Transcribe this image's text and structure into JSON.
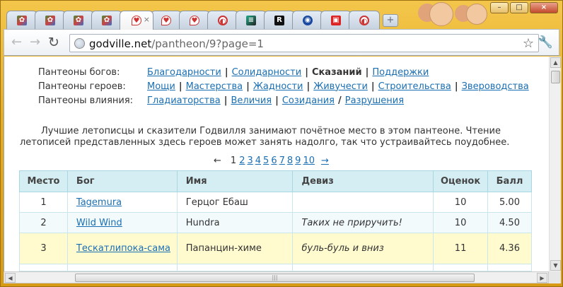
{
  "browser": {
    "tabs": [
      {
        "icon": "godville-icon",
        "glyph": "✿"
      },
      {
        "icon": "godville-icon",
        "glyph": "✿"
      },
      {
        "icon": "godville-icon",
        "glyph": "✿"
      },
      {
        "icon": "godville-icon",
        "glyph": "✿"
      },
      {
        "icon": "heart-shield-icon",
        "glyph": "♥",
        "active": true
      },
      {
        "icon": "heart-shield-icon",
        "glyph": "♥"
      },
      {
        "icon": "heart-shield-icon",
        "glyph": "♥"
      },
      {
        "icon": "red-circle-icon",
        "glyph": "◐"
      },
      {
        "icon": "stripe-icon",
        "glyph": "≡"
      },
      {
        "icon": "r-icon",
        "glyph": "R"
      },
      {
        "icon": "blue-circle-icon",
        "glyph": "◉"
      },
      {
        "icon": "gift-icon",
        "glyph": "▣"
      },
      {
        "icon": "red-circle-icon",
        "glyph": "◐"
      }
    ],
    "close_tab_glyph": "×",
    "new_tab_glyph": "+",
    "url_host": "godville.net",
    "url_path": "/pantheon/9?page=1",
    "window_controls": {
      "minimize": "–",
      "maximize": "□",
      "close": "×"
    }
  },
  "menu": {
    "rows": [
      {
        "label": "Пантеоны богов:",
        "items": [
          {
            "text": "Благодарности",
            "link": true
          },
          {
            "text": "Солидарности",
            "link": true
          },
          {
            "text": "Сказаний",
            "link": false
          },
          {
            "text": "Поддержки",
            "link": true
          }
        ],
        "separators": [
          "|",
          "|",
          "|"
        ]
      },
      {
        "label": "Пантеоны героев:",
        "items": [
          {
            "text": "Мощи",
            "link": true
          },
          {
            "text": "Мастерства",
            "link": true
          },
          {
            "text": "Жадности",
            "link": true
          },
          {
            "text": "Живучести",
            "link": true
          },
          {
            "text": "Строительства",
            "link": true
          },
          {
            "text": "Звероводства",
            "link": true
          }
        ],
        "separators": [
          "|",
          "|",
          "|",
          "|",
          "|"
        ]
      },
      {
        "label": "Пантеоны влияния:",
        "items": [
          {
            "text": "Гладиаторства",
            "link": true
          },
          {
            "text": "Величия",
            "link": true
          },
          {
            "text": "Созидания",
            "link": true
          },
          {
            "text": "Разрушения",
            "link": true
          }
        ],
        "separators": [
          "|",
          "|",
          "/"
        ]
      }
    ]
  },
  "intro": "Лучшие летописцы и сказители Годвилля занимают почётное место в этом пантеоне. Чтение летописей представленных здесь героев может занять надолго, так что устраивайтесь поудобнее.",
  "pager": {
    "prev": "←",
    "current": "1",
    "pages": [
      "2",
      "3",
      "4",
      "5",
      "6",
      "7",
      "8",
      "9",
      "10"
    ],
    "next": "→"
  },
  "table": {
    "headers": [
      "Место",
      "Бог",
      "Имя",
      "Девиз",
      "Оценок",
      "Балл"
    ],
    "rows": [
      {
        "place": "1",
        "god": "Tagemura",
        "name": "Герцог Ебаш",
        "motto": "",
        "ratings": "10",
        "score": "5.00"
      },
      {
        "place": "2",
        "god": "Wild Wind",
        "name": "Hundra",
        "motto": "Таких не приручить!",
        "ratings": "10",
        "score": "4.50"
      },
      {
        "place": "3",
        "god": "Тескатлипока-сама",
        "name": "Папанцин-химе",
        "motto": "буль-буль и вниз",
        "ratings": "11",
        "score": "4.36"
      }
    ]
  }
}
